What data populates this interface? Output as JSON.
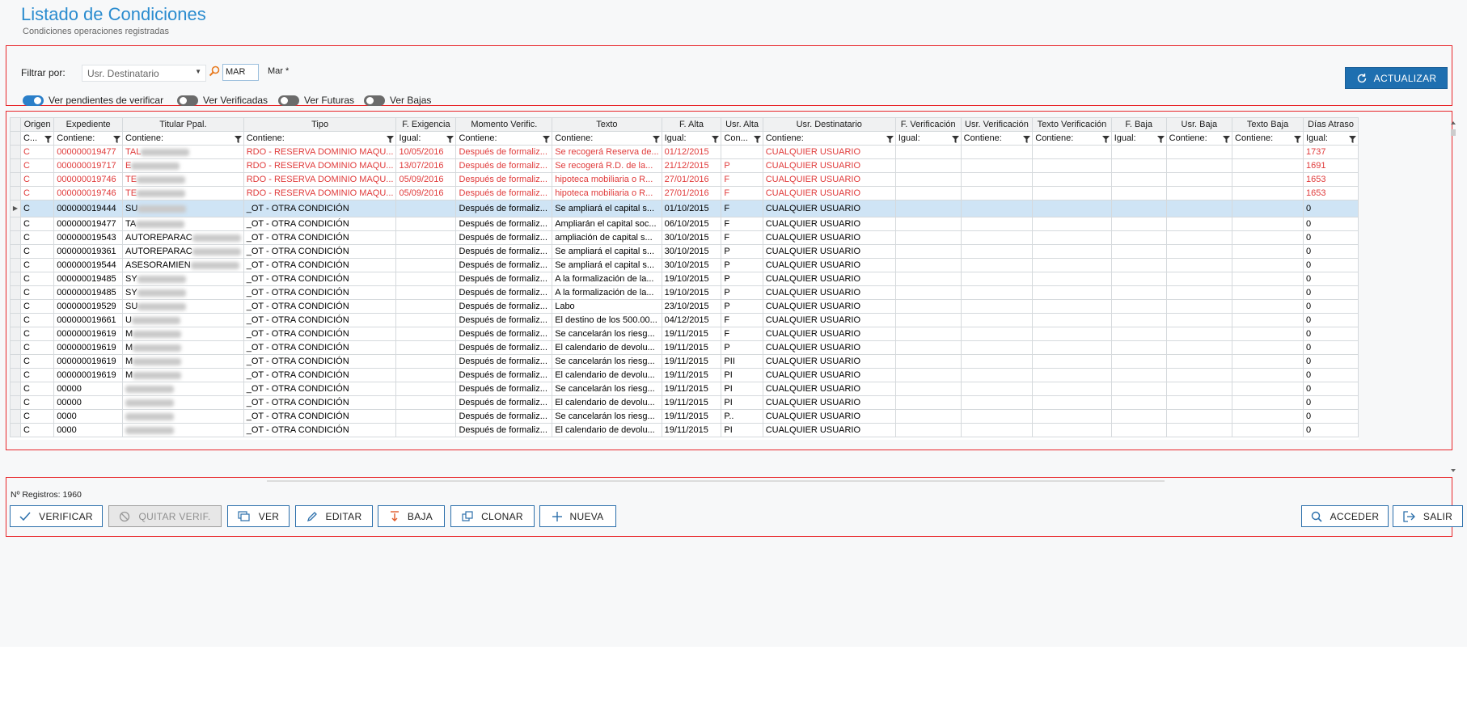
{
  "header": {
    "title": "Listado  de Condiciones",
    "subtitle": "Condiciones operaciones registradas"
  },
  "filters": {
    "label": "Filtrar por:",
    "field": "Usr. Destinatario",
    "value": "MAR",
    "value_match": "Mar *",
    "toggles": [
      {
        "label": "Ver pendientes de verificar",
        "on": true
      },
      {
        "label": "Ver Verificadas",
        "on": false
      },
      {
        "label": "Ver Futuras",
        "on": false
      },
      {
        "label": "Ver Bajas",
        "on": false
      }
    ],
    "refresh_label": "ACTUALIZAR"
  },
  "grid": {
    "columns": [
      "Origen",
      "Expediente",
      "Titular Ppal.",
      "Tipo",
      "F. Exigencia",
      "Momento Verific.",
      "Texto",
      "F. Alta",
      "Usr. Alta",
      "Usr. Destinatario",
      "F. Verificación",
      "Usr. Verificación",
      "Texto Verificación",
      "F. Baja",
      "Usr. Baja",
      "Texto Baja",
      "Días Atraso"
    ],
    "filters": [
      "C...",
      "Contiene:",
      "Contiene:",
      "Contiene:",
      "Igual:",
      "Contiene:",
      "Contiene:",
      "Igual:",
      "Con...",
      "Contiene:",
      "Igual:",
      "Contiene:",
      "Contiene:",
      "Igual:",
      "Contiene:",
      "Contiene:",
      "Igual:"
    ],
    "rows": [
      {
        "style": "red",
        "origen": "C",
        "expediente": "000000019477",
        "titular": "TAL",
        "tipo": "RDO - RESERVA DOMINIO MAQU...",
        "f_exigencia": "10/05/2016",
        "momento": "Después de formaliz...",
        "texto": "Se recogerá Reserva de...",
        "f_alta": "01/12/2015",
        "usr_alta": "",
        "usr_dest": "CUALQUIER USUARIO",
        "dias": "1737"
      },
      {
        "style": "red",
        "origen": "C",
        "expediente": "000000019717",
        "titular": "E",
        "tipo": "RDO - RESERVA DOMINIO MAQU...",
        "f_exigencia": "13/07/2016",
        "momento": "Después de formaliz...",
        "texto": "Se recogerá R.D. de la...",
        "f_alta": "21/12/2015",
        "usr_alta": "P",
        "usr_dest": "CUALQUIER USUARIO",
        "dias": "1691"
      },
      {
        "style": "red",
        "origen": "C",
        "expediente": "000000019746",
        "titular": "TE",
        "tipo": "RDO - RESERVA DOMINIO MAQU...",
        "f_exigencia": "05/09/2016",
        "momento": "Después de formaliz...",
        "texto": "hipoteca mobiliaria o R...",
        "f_alta": "27/01/2016",
        "usr_alta": "F",
        "usr_dest": "CUALQUIER USUARIO",
        "dias": "1653"
      },
      {
        "style": "red",
        "origen": "C",
        "expediente": "000000019746",
        "titular": "TE",
        "tipo": "RDO - RESERVA DOMINIO MAQU...",
        "f_exigencia": "05/09/2016",
        "momento": "Después de formaliz...",
        "texto": "hipoteca mobiliaria o R...",
        "f_alta": "27/01/2016",
        "usr_alta": "F",
        "usr_dest": "CUALQUIER USUARIO",
        "dias": "1653"
      },
      {
        "style": "sel",
        "origen": "C",
        "expediente": "000000019444",
        "titular": "SU",
        "tipo": "_OT - OTRA CONDICIÓN",
        "f_exigencia": "",
        "momento": "Después de formaliz...",
        "texto": "Se ampliará el capital s...",
        "f_alta": "01/10/2015",
        "usr_alta": "F",
        "usr_dest": "CUALQUIER USUARIO",
        "dias": "0"
      },
      {
        "style": "",
        "origen": "C",
        "expediente": "000000019477",
        "titular": "TA",
        "tipo": "_OT - OTRA CONDICIÓN",
        "f_exigencia": "",
        "momento": "Después de formaliz...",
        "texto": "Ampliarán el capital soc...",
        "f_alta": "06/10/2015",
        "usr_alta": "F",
        "usr_dest": "CUALQUIER USUARIO",
        "dias": "0"
      },
      {
        "style": "",
        "origen": "C",
        "expediente": "000000019543",
        "titular": "AUTOREPARAC",
        "tipo": "_OT - OTRA CONDICIÓN",
        "f_exigencia": "",
        "momento": "Después de formaliz...",
        "texto": "ampliación de capital s...",
        "f_alta": "30/10/2015",
        "usr_alta": "F",
        "usr_dest": "CUALQUIER USUARIO",
        "dias": "0"
      },
      {
        "style": "",
        "origen": "C",
        "expediente": "000000019361",
        "titular": "AUTOREPARAC",
        "tipo": "_OT - OTRA CONDICIÓN",
        "f_exigencia": "",
        "momento": "Después de formaliz...",
        "texto": "Se ampliará el capital s...",
        "f_alta": "30/10/2015",
        "usr_alta": "P",
        "usr_dest": "CUALQUIER USUARIO",
        "dias": "0"
      },
      {
        "style": "",
        "origen": "C",
        "expediente": "000000019544",
        "titular": "ASESORAMIEN",
        "tipo": "_OT - OTRA CONDICIÓN",
        "f_exigencia": "",
        "momento": "Después de formaliz...",
        "texto": "Se ampliará el capital s...",
        "f_alta": "30/10/2015",
        "usr_alta": "P",
        "usr_dest": "CUALQUIER USUARIO",
        "dias": "0"
      },
      {
        "style": "",
        "origen": "C",
        "expediente": "000000019485",
        "titular": "SY",
        "tipo": "_OT - OTRA CONDICIÓN",
        "f_exigencia": "",
        "momento": "Después de formaliz...",
        "texto": "A la formalización de la...",
        "f_alta": "19/10/2015",
        "usr_alta": "P",
        "usr_dest": "CUALQUIER USUARIO",
        "dias": "0"
      },
      {
        "style": "",
        "origen": "C",
        "expediente": "000000019485",
        "titular": "SY",
        "tipo": "_OT - OTRA CONDICIÓN",
        "f_exigencia": "",
        "momento": "Después de formaliz...",
        "texto": "A la formalización de la...",
        "f_alta": "19/10/2015",
        "usr_alta": "P",
        "usr_dest": "CUALQUIER USUARIO",
        "dias": "0"
      },
      {
        "style": "",
        "origen": "C",
        "expediente": "000000019529",
        "titular": "SU",
        "tipo": "_OT - OTRA CONDICIÓN",
        "f_exigencia": "",
        "momento": "Después de formaliz...",
        "texto": "Labo",
        "f_alta": "23/10/2015",
        "usr_alta": "P",
        "usr_dest": "CUALQUIER USUARIO",
        "dias": "0"
      },
      {
        "style": "",
        "origen": "C",
        "expediente": "000000019661",
        "titular": "U",
        "tipo": "_OT - OTRA CONDICIÓN",
        "f_exigencia": "",
        "momento": "Después de formaliz...",
        "texto": "El destino de los 500.00...",
        "f_alta": "04/12/2015",
        "usr_alta": "F",
        "usr_dest": "CUALQUIER USUARIO",
        "dias": "0"
      },
      {
        "style": "",
        "origen": "C",
        "expediente": "000000019619",
        "titular": "M",
        "tipo": "_OT - OTRA CONDICIÓN",
        "f_exigencia": "",
        "momento": "Después de formaliz...",
        "texto": "Se cancelarán los riesg...",
        "f_alta": "19/11/2015",
        "usr_alta": "F",
        "usr_dest": "CUALQUIER USUARIO",
        "dias": "0"
      },
      {
        "style": "",
        "origen": "C",
        "expediente": "000000019619",
        "titular": "M",
        "tipo": "_OT - OTRA CONDICIÓN",
        "f_exigencia": "",
        "momento": "Después de formaliz...",
        "texto": "El calendario de devolu...",
        "f_alta": "19/11/2015",
        "usr_alta": "P",
        "usr_dest": "CUALQUIER USUARIO",
        "dias": "0"
      },
      {
        "style": "",
        "origen": "C",
        "expediente": "000000019619",
        "titular": "M",
        "tipo": "_OT - OTRA CONDICIÓN",
        "f_exigencia": "",
        "momento": "Después de formaliz...",
        "texto": "Se cancelarán los riesg...",
        "f_alta": "19/11/2015",
        "usr_alta": "PII",
        "usr_dest": "CUALQUIER USUARIO",
        "dias": "0"
      },
      {
        "style": "",
        "origen": "C",
        "expediente": "000000019619",
        "titular": "M",
        "tipo": "_OT - OTRA CONDICIÓN",
        "f_exigencia": "",
        "momento": "Después de formaliz...",
        "texto": "El calendario de devolu...",
        "f_alta": "19/11/2015",
        "usr_alta": "PI",
        "usr_dest": "CUALQUIER USUARIO",
        "dias": "0"
      },
      {
        "style": "",
        "origen": "C",
        "expediente": "00000",
        "titular": "",
        "tipo": "_OT - OTRA CONDICIÓN",
        "f_exigencia": "",
        "momento": "Después de formaliz...",
        "texto": "Se cancelarán los riesg...",
        "f_alta": "19/11/2015",
        "usr_alta": "PI",
        "usr_dest": "CUALQUIER USUARIO",
        "dias": "0"
      },
      {
        "style": "",
        "origen": "C",
        "expediente": "00000",
        "titular": "",
        "tipo": "_OT - OTRA CONDICIÓN",
        "f_exigencia": "",
        "momento": "Después de formaliz...",
        "texto": "El calendario de devolu...",
        "f_alta": "19/11/2015",
        "usr_alta": "PI",
        "usr_dest": "CUALQUIER USUARIO",
        "dias": "0"
      },
      {
        "style": "",
        "origen": "C",
        "expediente": "0000",
        "titular": "",
        "tipo": "_OT - OTRA CONDICIÓN",
        "f_exigencia": "",
        "momento": "Después de formaliz...",
        "texto": "Se cancelarán los riesg...",
        "f_alta": "19/11/2015",
        "usr_alta": "P..",
        "usr_dest": "CUALQUIER USUARIO",
        "dias": "0"
      },
      {
        "style": "",
        "origen": "C",
        "expediente": "0000",
        "titular": "",
        "tipo": "_OT - OTRA CONDICIÓN",
        "f_exigencia": "",
        "momento": "Después de formaliz...",
        "texto": "El calendario de devolu...",
        "f_alta": "19/11/2015",
        "usr_alta": "PI",
        "usr_dest": "CUALQUIER USUARIO",
        "dias": "0"
      }
    ]
  },
  "footer": {
    "records": "Nº Registros: 1960",
    "buttons": {
      "verificar": "VERIFICAR",
      "quitar": "QUITAR VERIF.",
      "ver": "VER",
      "editar": "EDITAR",
      "baja": "BAJA",
      "clonar": "CLONAR",
      "nueva": "NUEVA",
      "acceder": "ACCEDER",
      "salir": "SALIR"
    }
  },
  "colors": {
    "accent": "#2b8ccf",
    "button": "#1e6fb0",
    "highlight": "#e8262a",
    "row_red": "#e03b3b",
    "selected": "#cfe4f5"
  }
}
